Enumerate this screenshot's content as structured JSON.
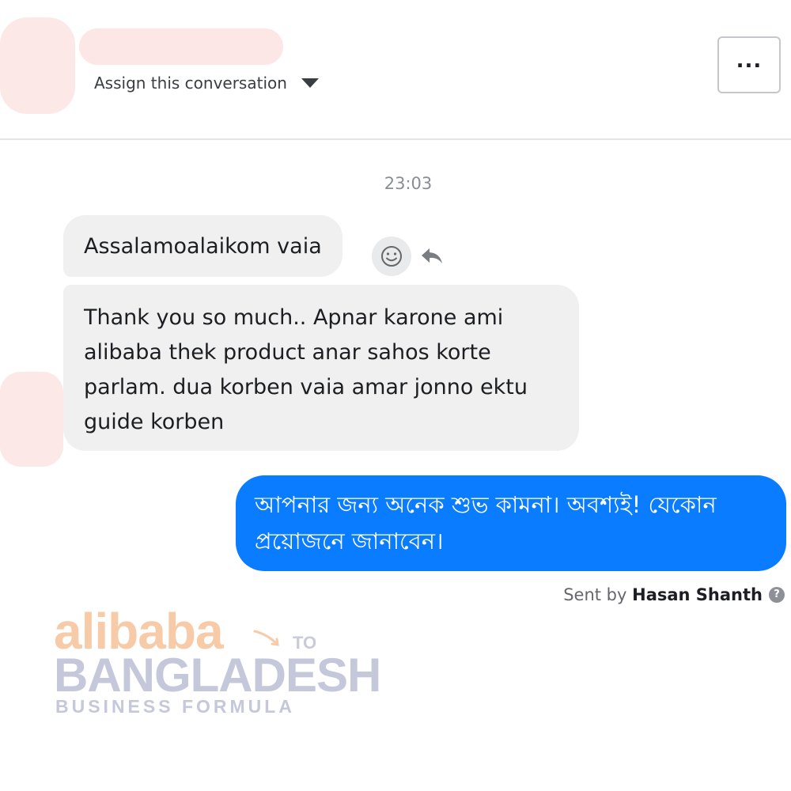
{
  "header": {
    "assign_label": "Assign this conversation",
    "more_label": "..."
  },
  "thread": {
    "timestamp": "23:03",
    "incoming": [
      "Assalamoalaikom vaia",
      "Thank you so much.. Apnar karone ami alibaba thek product anar sahos korte parlam. dua korben vaia amar jonno ektu guide korben"
    ],
    "outgoing": [
      "আপনার জন্য অনেক শুভ কামনা। অবশ্যই! যেকোন প্রয়োজনে জানাবেন।"
    ],
    "sent_by_prefix": "Sent by",
    "sent_by_name": "Hasan Shanth"
  },
  "watermark": {
    "brand": "alibaba",
    "to": "TO",
    "country": "BANGLADESH",
    "tagline": "BUSINESS FORMULA"
  },
  "colors": {
    "outgoing_bubble": "#0a7cff",
    "incoming_bubble": "#f0f0f0",
    "redaction": "#fde8e8"
  }
}
